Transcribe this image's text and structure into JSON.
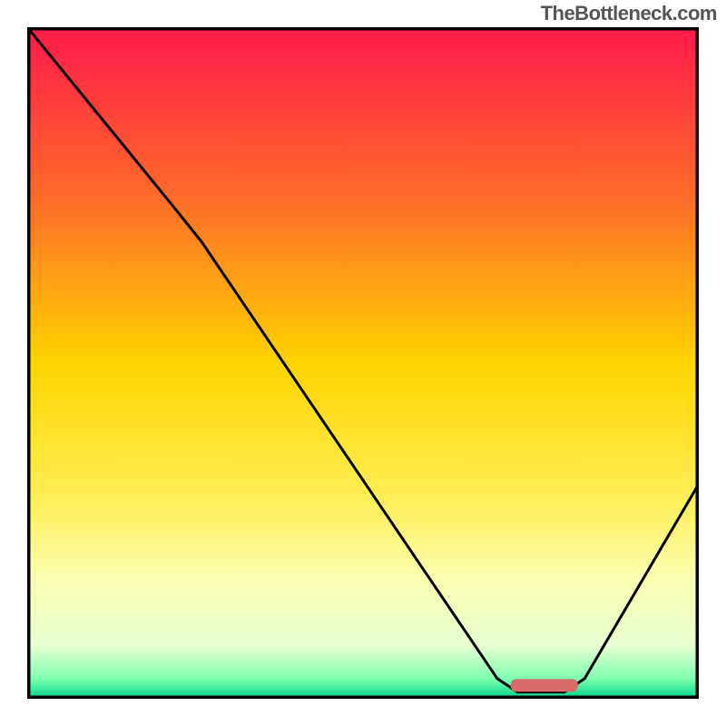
{
  "watermark": "TheBottleneck.com",
  "chart_data": {
    "type": "line",
    "title": "",
    "xlabel": "",
    "ylabel": "",
    "x_range": [
      0,
      100
    ],
    "y_range": [
      0,
      100
    ],
    "gradient_stops": [
      {
        "offset": 0,
        "color": "#ff1a4a"
      },
      {
        "offset": 0.25,
        "color": "#ff6a2a"
      },
      {
        "offset": 0.5,
        "color": "#ffd400"
      },
      {
        "offset": 0.7,
        "color": "#ffee55"
      },
      {
        "offset": 0.82,
        "color": "#fbffb0"
      },
      {
        "offset": 0.92,
        "color": "#e8ffd0"
      },
      {
        "offset": 0.97,
        "color": "#7fffb0"
      },
      {
        "offset": 1.0,
        "color": "#00d38a"
      }
    ],
    "curve": [
      {
        "x": 0,
        "y": 100
      },
      {
        "x": 22,
        "y": 73
      },
      {
        "x": 26,
        "y": 68
      },
      {
        "x": 70,
        "y": 3
      },
      {
        "x": 73,
        "y": 1
      },
      {
        "x": 80,
        "y": 1
      },
      {
        "x": 83,
        "y": 3
      },
      {
        "x": 100,
        "y": 32
      }
    ],
    "optimal_marker": {
      "x_start": 72,
      "x_end": 82,
      "y": 2,
      "color": "#d86a6a"
    }
  }
}
